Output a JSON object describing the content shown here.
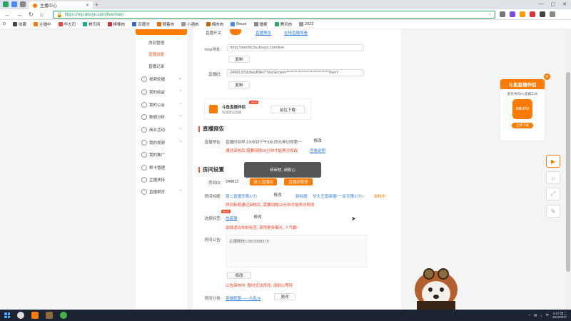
{
  "browser": {
    "tab_title": "主播中心",
    "url_scheme": "https://",
    "url_rest": "mp.douyu.com/live/main",
    "bookmarks": [
      "收藏",
      "主播中",
      "华大司",
      "棋乐网",
      "棒棒肉",
      "百度时",
      "随着肉",
      "小酒肉",
      "棉肉肉",
      "Rouni",
      "播棍",
      "腾讯肉",
      "2022"
    ]
  },
  "sidebar": {
    "items": [
      {
        "label": "房间管理",
        "type": "sub"
      },
      {
        "label": "直播设置",
        "type": "sub",
        "active": true
      },
      {
        "label": "直播记录",
        "type": "sub"
      },
      {
        "label": "视频轮播",
        "type": "group",
        "caret": "+"
      },
      {
        "label": "我的收益",
        "type": "group",
        "caret": "^"
      },
      {
        "label": "我的公会",
        "type": "group",
        "caret": "^"
      },
      {
        "label": "数据分析",
        "type": "group",
        "caret": "^"
      },
      {
        "label": "商业活动",
        "type": "group",
        "caret": "^"
      },
      {
        "label": "我的视频",
        "type": "group",
        "caret": "^"
      },
      {
        "label": "我的推广",
        "type": "group"
      },
      {
        "label": "帮卡管理",
        "type": "group"
      },
      {
        "label": "主播扶持",
        "type": "group"
      },
      {
        "label": "直播帮货",
        "type": "group",
        "caret": "^"
      }
    ]
  },
  "stream": {
    "top_label": "直播开关",
    "top_link": "直播预览",
    "top_link2": "在线直播观看",
    "rtmp_label": "rtmp地址:",
    "rtmp_value": "rtmp://sendtc3a.douyu.com/live",
    "copy1": "复制",
    "key_label": "直播码:",
    "key_value": "249813rSUboyB8H7?wsSecret=****************************8wsT",
    "copy2": "复制"
  },
  "companion": {
    "title": "斗鱼直播伴侣",
    "subtitle": "快速建设直播",
    "badge": "NEW",
    "button": "前往下载"
  },
  "preview": {
    "section": "直播预告",
    "label": "直播预告:",
    "text": "直播时间早上9点到下午3点,同元神记得第一",
    "edit": "修改",
    "note": "通过审核后,需要间隔10分钟才能再次修改",
    "link": "查看说明"
  },
  "room": {
    "section": "房间设置",
    "toast": "待审核, 请耐心",
    "id_label": "房间ID:",
    "id_value": "249813",
    "enter_btn": "进入直播间",
    "manage_btn": "直播间管理",
    "title_label": "房间标题:",
    "title_value": "周二直播无限火力",
    "title_edit": "修改",
    "new_title_label": "新标题:",
    "new_title_value": "华大王国串播! 一杀无限火力~",
    "pending": "审核中",
    "title_note": "房间标题通过审核后, 需要间隔10分钟才能再次修改",
    "select_label": "选择标签:",
    "select_badge": "NEW",
    "select_value": "热搞事",
    "select_edit": "修改",
    "select_note": "选择适合你的标签, 获得更多曝光, 人气翻~",
    "notice_label": "房间公告:",
    "notice_value": "主播微信17803358579",
    "notice_edit": "修改",
    "notice_note": "公告审核中, 暂时无法修改, 请耐心等待",
    "category_label": "房间分类:",
    "category_value": "英雄联盟——大乱斗",
    "category_edit": "更改"
  },
  "promo": {
    "title": "斗鱼直播伴侣",
    "subtitle": "超优秀的PC直播工具",
    "app_name": "DOUYU",
    "download": "立即下载"
  },
  "taskbar": {
    "time": "9:07 周二",
    "date": "2022/9/27"
  }
}
